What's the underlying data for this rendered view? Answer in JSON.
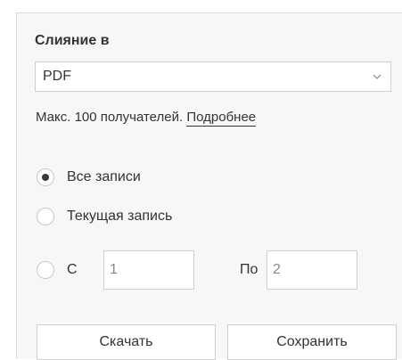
{
  "panel": {
    "title": "Слияние в",
    "format_select": {
      "value": "PDF",
      "icon": "chevron-down-icon"
    },
    "hint": {
      "text": "Макс. 100 получателей. ",
      "link": "Подробнее"
    },
    "records": {
      "options": [
        {
          "label": "Все записи",
          "checked": true
        },
        {
          "label": "Текущая запись",
          "checked": false
        }
      ],
      "range": {
        "from_label": "С",
        "from_value": "1",
        "to_label": "По",
        "to_value": "2",
        "checked": false
      }
    },
    "buttons": {
      "download": "Скачать",
      "save": "Сохранить"
    }
  }
}
